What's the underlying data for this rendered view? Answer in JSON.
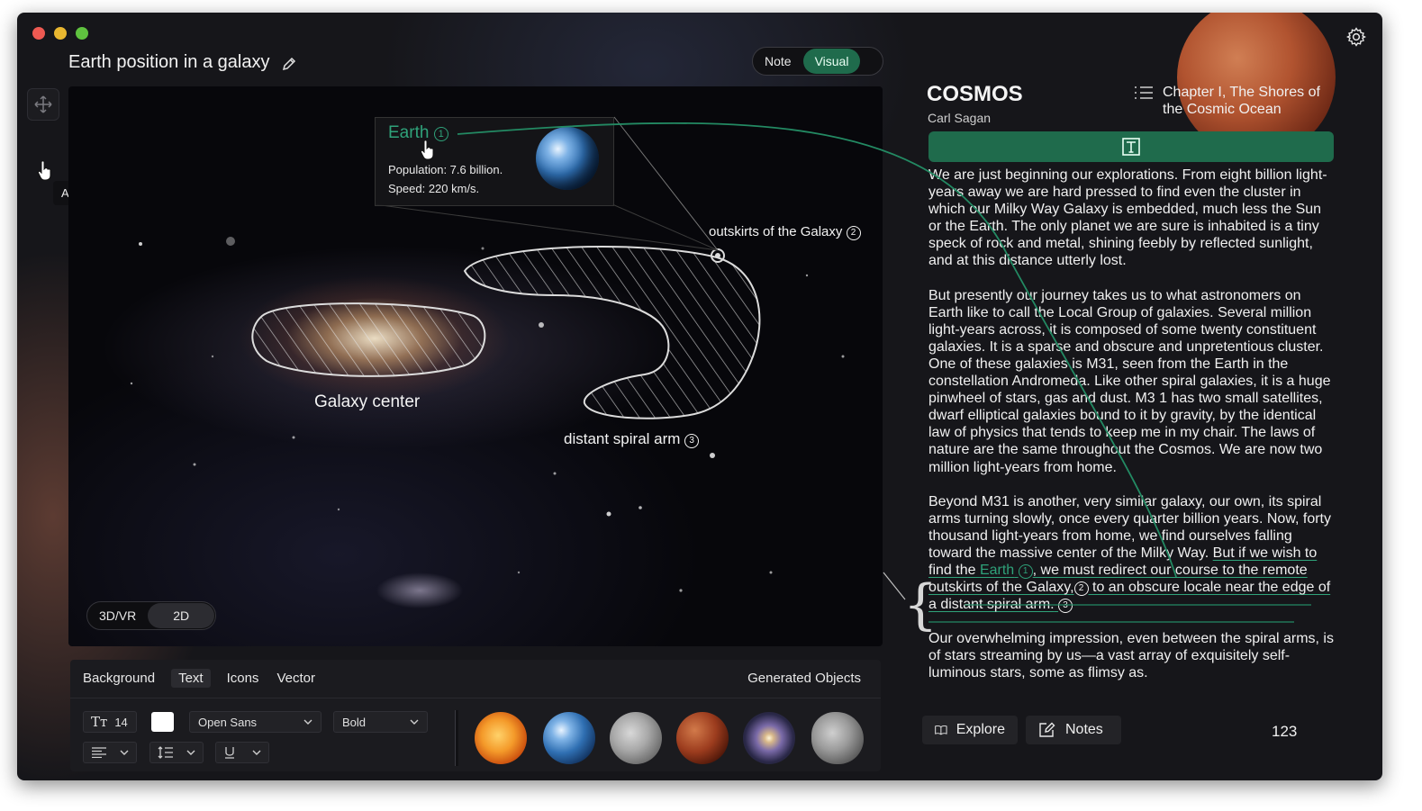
{
  "window": {
    "title": "Earth position in a galaxy",
    "traffic_lights": [
      "#ee5a52",
      "#e9b730",
      "#5fc23f"
    ]
  },
  "mode_toggle": {
    "options": [
      "Note",
      "Visual"
    ],
    "selected": "Visual"
  },
  "left_tools": {
    "move": "move-icon",
    "add_text": "text-icon",
    "tooltip": "Add Text"
  },
  "canvas": {
    "popup": {
      "title": "Earth",
      "title_num": "1",
      "population": "Population: 7.6 billion.",
      "speed": "Speed: 220 km/s."
    },
    "labels": {
      "outskirts": "outskirts of the Galaxy",
      "outskirts_num": "2",
      "galaxy_center": "Galaxy center",
      "spiral_arm": "distant spiral arm",
      "spiral_arm_num": "3"
    },
    "view_toggle": {
      "options": [
        "3D/VR",
        "2D"
      ],
      "selected": "2D"
    }
  },
  "bottom_panel": {
    "tabs": [
      "Background",
      "Text",
      "Icons",
      "Vector"
    ],
    "active_tab": "Text",
    "generated_label": "Generated Objects",
    "font_size": "14",
    "font_family": "Open Sans",
    "font_weight": "Bold",
    "text_color": "#ffffff",
    "objects": [
      "Sun",
      "Earth",
      "Moon",
      "Mars",
      "Galaxy",
      "Asteroid"
    ]
  },
  "reader": {
    "book_title": "COSMOS",
    "author": "Carl Sagan",
    "chapter": "Chapter I, The Shores of the Cosmic Ocean",
    "paragraphs": [
      "We are just beginning our explorations. From eight billion light-years away we are hard pressed to find even the cluster in which our Milky Way Galaxy is embedded, much less the Sun or the Earth. The only planet we are sure is inhabited is a tiny speck of rock and metal, shining feebly by reflected sunlight, and at this distance utterly lost.",
      "But presently our journey takes us to what astronomers on Earth like to call the Local Group of galaxies. Several million light-years across, it is composed of some twenty constituent galaxies. It is a sparse and obscure and unpretentious cluster. One of these galaxies is M31, seen from the Earth in the constellation Andromeda. Like other spiral galaxies, it is a huge pinwheel of stars, gas and dust. M3 1 has two small satellites, dwarf elliptical galaxies bound to it by gravity, by the identical law of physics that tends to keep me in my chair. The laws of nature are the same throughout the Cosmos. We are now two million light-years from home.",
      "Our overwhelming impression, even between the spiral arms, is of stars streaming by us—a vast array of exquisitely self-luminous stars, some as flimsy as."
    ],
    "p3_start": "Beyond M31 is another, very similar galaxy, our own, its spiral arms turning slowly, once every quarter billion years. Now, forty thousand light-years from home, we find ourselves falling toward the massive center of the Milky Way.",
    "p3_link_a": "But if we wish to find the",
    "p3_link_earth": "Earth",
    "p3_num1": "1",
    "p3_link_b": ", we must redirect our course to the remote outskirts of the Galaxy,",
    "p3_num2": "2",
    "p3_link_c": "to an obscure locale near the edge of a distant spiral arm.",
    "p3_num3": "3",
    "explore": "Explore",
    "notes": "Notes",
    "page_number": "123",
    "accent": "#2fa27a"
  }
}
